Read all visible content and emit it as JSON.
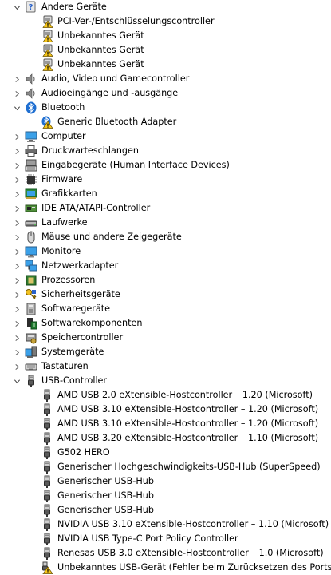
{
  "tree": {
    "nodes": [
      {
        "level": 0,
        "expander": "collapse",
        "icon": "unknown-device-icon",
        "label": "Andere Geräte"
      },
      {
        "level": 1,
        "expander": "none",
        "icon": "warning-device-icon",
        "label": "PCI-Ver-/Entschlüsselungscontroller"
      },
      {
        "level": 1,
        "expander": "none",
        "icon": "warning-device-icon",
        "label": "Unbekanntes Gerät"
      },
      {
        "level": 1,
        "expander": "none",
        "icon": "warning-device-icon",
        "label": "Unbekanntes Gerät"
      },
      {
        "level": 1,
        "expander": "none",
        "icon": "warning-device-icon",
        "label": "Unbekanntes Gerät"
      },
      {
        "level": 0,
        "expander": "expand",
        "icon": "speaker-icon",
        "label": "Audio, Video und Gamecontroller"
      },
      {
        "level": 0,
        "expander": "expand",
        "icon": "speaker-icon",
        "label": "Audioeingänge und -ausgänge"
      },
      {
        "level": 0,
        "expander": "collapse",
        "icon": "bluetooth-icon",
        "label": "Bluetooth"
      },
      {
        "level": 1,
        "expander": "none",
        "icon": "bluetooth-warning-icon",
        "label": "Generic Bluetooth Adapter"
      },
      {
        "level": 0,
        "expander": "expand",
        "icon": "computer-icon",
        "label": "Computer"
      },
      {
        "level": 0,
        "expander": "expand",
        "icon": "printer-icon",
        "label": "Druckwarteschlangen"
      },
      {
        "level": 0,
        "expander": "expand",
        "icon": "keyboard-hid-icon",
        "label": "Eingabegeräte (Human Interface Devices)"
      },
      {
        "level": 0,
        "expander": "expand",
        "icon": "firmware-chip-icon",
        "label": "Firmware"
      },
      {
        "level": 0,
        "expander": "expand",
        "icon": "display-adapter-icon",
        "label": "Grafikkarten"
      },
      {
        "level": 0,
        "expander": "expand",
        "icon": "ide-controller-icon",
        "label": "IDE ATA/ATAPI-Controller"
      },
      {
        "level": 0,
        "expander": "expand",
        "icon": "disk-drive-icon",
        "label": "Laufwerke"
      },
      {
        "level": 0,
        "expander": "expand",
        "icon": "mouse-icon",
        "label": "Mäuse und andere Zeigegeräte"
      },
      {
        "level": 0,
        "expander": "expand",
        "icon": "monitor-icon",
        "label": "Monitore"
      },
      {
        "level": 0,
        "expander": "expand",
        "icon": "network-adapter-icon",
        "label": "Netzwerkadapter"
      },
      {
        "level": 0,
        "expander": "expand",
        "icon": "processor-icon",
        "label": "Prozessoren"
      },
      {
        "level": 0,
        "expander": "expand",
        "icon": "security-key-icon",
        "label": "Sicherheitsgeräte"
      },
      {
        "level": 0,
        "expander": "expand",
        "icon": "software-device-icon",
        "label": "Softwaregeräte"
      },
      {
        "level": 0,
        "expander": "expand",
        "icon": "software-component-icon",
        "label": "Softwarekomponenten"
      },
      {
        "level": 0,
        "expander": "expand",
        "icon": "storage-controller-icon",
        "label": "Speichercontroller"
      },
      {
        "level": 0,
        "expander": "expand",
        "icon": "system-devices-icon",
        "label": "Systemgeräte"
      },
      {
        "level": 0,
        "expander": "expand",
        "icon": "keyboard-icon",
        "label": "Tastaturen"
      },
      {
        "level": 0,
        "expander": "collapse",
        "icon": "usb-plug-icon",
        "label": "USB-Controller"
      },
      {
        "level": 1,
        "expander": "none",
        "icon": "usb-plug-icon",
        "label": "AMD USB 2.0 eXtensible-Hostcontroller – 1.20 (Microsoft)"
      },
      {
        "level": 1,
        "expander": "none",
        "icon": "usb-plug-icon",
        "label": "AMD USB 3.10 eXtensible-Hostcontroller – 1.20 (Microsoft)"
      },
      {
        "level": 1,
        "expander": "none",
        "icon": "usb-plug-icon",
        "label": "AMD USB 3.10 eXtensible-Hostcontroller – 1.20 (Microsoft)"
      },
      {
        "level": 1,
        "expander": "none",
        "icon": "usb-plug-icon",
        "label": "AMD USB 3.20 eXtensible-Hostcontroller – 1.10 (Microsoft)"
      },
      {
        "level": 1,
        "expander": "none",
        "icon": "usb-plug-icon",
        "label": "G502 HERO"
      },
      {
        "level": 1,
        "expander": "none",
        "icon": "usb-plug-icon",
        "label": "Generischer Hochgeschwindigkeits-USB-Hub (SuperSpeed)"
      },
      {
        "level": 1,
        "expander": "none",
        "icon": "usb-plug-icon",
        "label": "Generischer USB-Hub"
      },
      {
        "level": 1,
        "expander": "none",
        "icon": "usb-plug-icon",
        "label": "Generischer USB-Hub"
      },
      {
        "level": 1,
        "expander": "none",
        "icon": "usb-plug-icon",
        "label": "Generischer USB-Hub"
      },
      {
        "level": 1,
        "expander": "none",
        "icon": "usb-plug-icon",
        "label": "NVIDIA USB 3.10 eXtensible-Hostcontroller – 1.10 (Microsoft)"
      },
      {
        "level": 1,
        "expander": "none",
        "icon": "usb-plug-icon",
        "label": "NVIDIA USB Type-C Port Policy Controller"
      },
      {
        "level": 1,
        "expander": "none",
        "icon": "usb-plug-icon",
        "label": "Renesas USB 3.0 eXtensible-Hostcontroller – 1.0 (Microsoft)"
      },
      {
        "level": 1,
        "expander": "none",
        "icon": "usb-warning-icon",
        "label": "Unbekanntes USB-Gerät (Fehler beim Zurücksetzen des Ports.)"
      }
    ]
  }
}
